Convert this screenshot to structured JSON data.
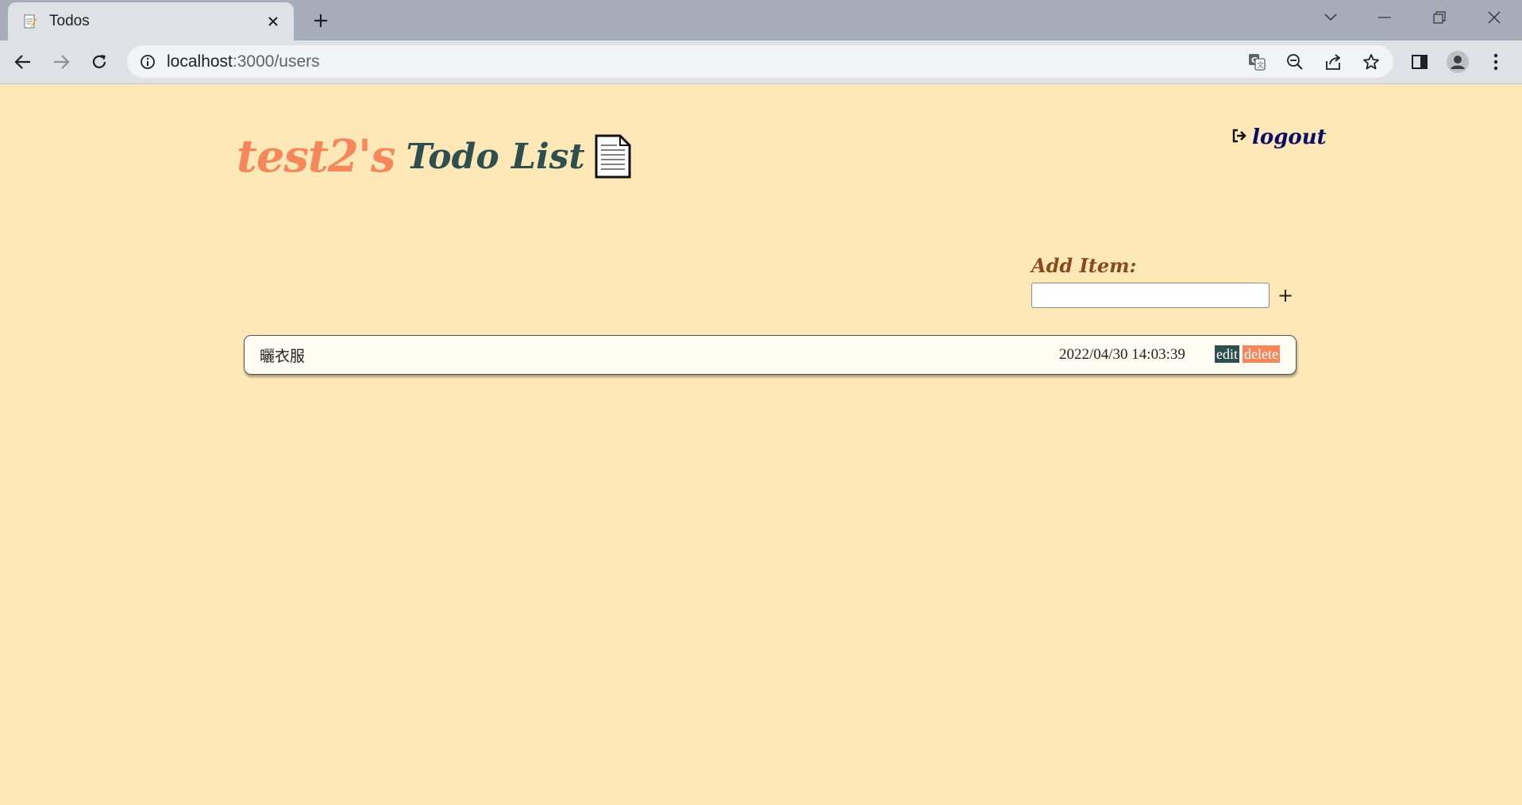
{
  "browser": {
    "tab_title": "Todos",
    "url_host": "localhost",
    "url_path": ":3000/users",
    "icons": [
      "favicon-memo-icon",
      "close-icon",
      "plus-icon",
      "back-icon",
      "forward-icon",
      "reload-icon",
      "info-icon",
      "translate-icon",
      "zoom-out-icon",
      "share-icon",
      "star-icon",
      "side-panel-icon",
      "profile-icon",
      "menu-icon",
      "tab-search-icon",
      "minimize-icon",
      "restore-icon",
      "window-close-icon"
    ]
  },
  "header": {
    "username": "test2's",
    "app_title": "Todo List",
    "logout_label": "logout"
  },
  "add_item": {
    "label": "Add Item:",
    "input_value": "",
    "button_label": "+"
  },
  "todos": [
    {
      "text": "曬衣服",
      "timestamp": "2022/04/30 14:03:39",
      "edit_label": "edit",
      "delete_label": "delete"
    }
  ],
  "colors": {
    "page_background": "#ffe8b8",
    "username": "#f5875a",
    "app_title": "#2f4f4f",
    "logout": "#0b0b66",
    "add_label": "#8a4a1e",
    "edit_button": "#2f4f4f",
    "delete_button": "#f5875a"
  }
}
